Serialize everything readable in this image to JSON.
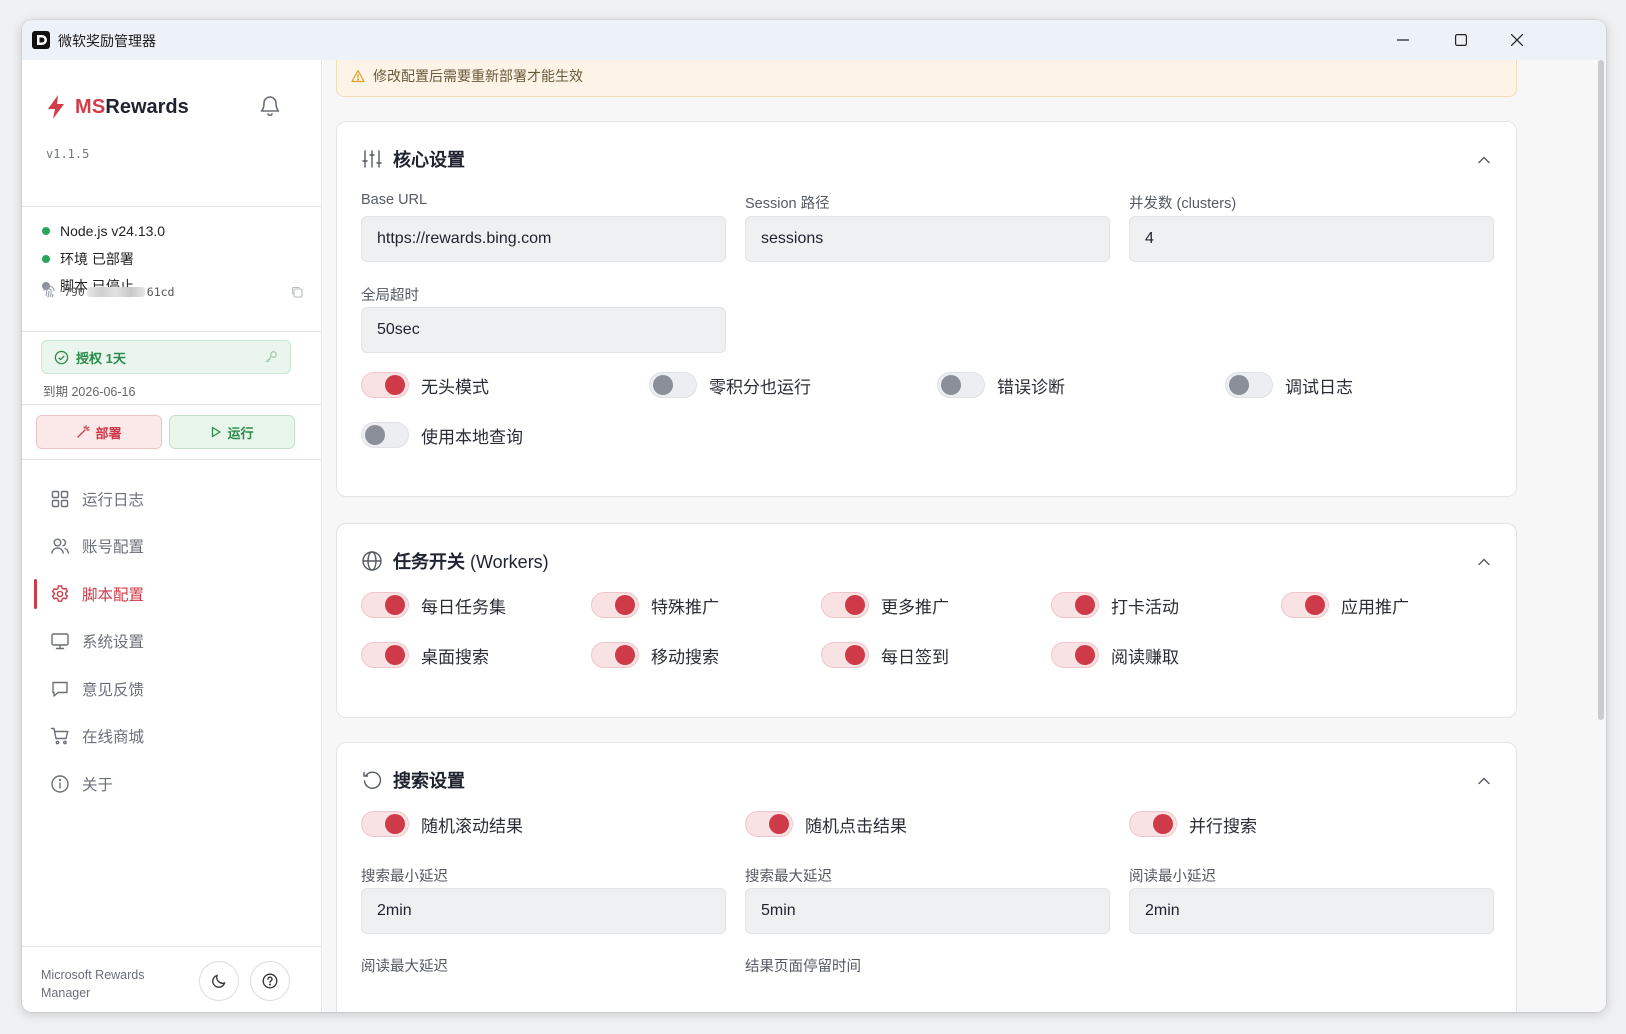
{
  "window": {
    "title": "微软奖励管理器"
  },
  "sidebar": {
    "brand_ms": "MS",
    "brand_rewards": "Rewards",
    "version": "v1.1.5",
    "status": [
      {
        "label": "Node.js v24.13.0",
        "color": "#27a55a"
      },
      {
        "label": "环境 已部署",
        "color": "#27a55a"
      },
      {
        "label": "脚本 已停止",
        "color": "#8b8f99"
      }
    ],
    "machine_id_prefix": "790",
    "machine_id_suffix": "61cd",
    "license_label": "授权 1天",
    "expiry": "到期 2026-06-16",
    "deploy_label": "部署",
    "run_label": "运行",
    "nav": [
      {
        "label": "运行日志",
        "icon": "grid-icon"
      },
      {
        "label": "账号配置",
        "icon": "users-icon"
      },
      {
        "label": "脚本配置",
        "icon": "gear-icon",
        "active": true
      },
      {
        "label": "系统设置",
        "icon": "monitor-icon"
      },
      {
        "label": "意见反馈",
        "icon": "message-icon"
      },
      {
        "label": "在线商城",
        "icon": "cart-icon"
      },
      {
        "label": "关于",
        "icon": "info-icon"
      }
    ],
    "footer": "Microsoft Rewards Manager"
  },
  "main": {
    "notice": "修改配置后需要重新部署才能生效",
    "core": {
      "title": "核心设置",
      "fields": [
        {
          "label": "Base URL",
          "value": "https://rewards.bing.com"
        },
        {
          "label": "Session 路径",
          "value": "sessions"
        },
        {
          "label": "并发数 (clusters)",
          "value": "4"
        },
        {
          "label": "全局超时",
          "value": "50sec"
        }
      ],
      "toggles": [
        {
          "label": "无头模式",
          "on": true
        },
        {
          "label": "零积分也运行",
          "on": false
        },
        {
          "label": "错误诊断",
          "on": false
        },
        {
          "label": "调试日志",
          "on": false
        },
        {
          "label": "使用本地查询",
          "on": false
        }
      ]
    },
    "workers": {
      "title": "任务开关",
      "title_en": "(Workers)",
      "toggles": [
        {
          "label": "每日任务集",
          "on": true
        },
        {
          "label": "特殊推广",
          "on": true
        },
        {
          "label": "更多推广",
          "on": true
        },
        {
          "label": "打卡活动",
          "on": true
        },
        {
          "label": "应用推广",
          "on": true
        },
        {
          "label": "桌面搜索",
          "on": true
        },
        {
          "label": "移动搜索",
          "on": true
        },
        {
          "label": "每日签到",
          "on": true
        },
        {
          "label": "阅读赚取",
          "on": true
        }
      ]
    },
    "search": {
      "title": "搜索设置",
      "toggles": [
        {
          "label": "随机滚动结果",
          "on": true
        },
        {
          "label": "随机点击结果",
          "on": true
        },
        {
          "label": "并行搜索",
          "on": true
        }
      ],
      "fields": [
        {
          "label": "搜索最小延迟",
          "value": "2min"
        },
        {
          "label": "搜索最大延迟",
          "value": "5min"
        },
        {
          "label": "阅读最小延迟",
          "value": "2min"
        },
        {
          "label": "阅读最大延迟",
          "value": ""
        },
        {
          "label": "结果页面停留时间",
          "value": ""
        }
      ]
    }
  },
  "colors": {
    "accent": "#cf3a48",
    "success": "#27a55a",
    "warning_bg": "#fdf4e7"
  }
}
